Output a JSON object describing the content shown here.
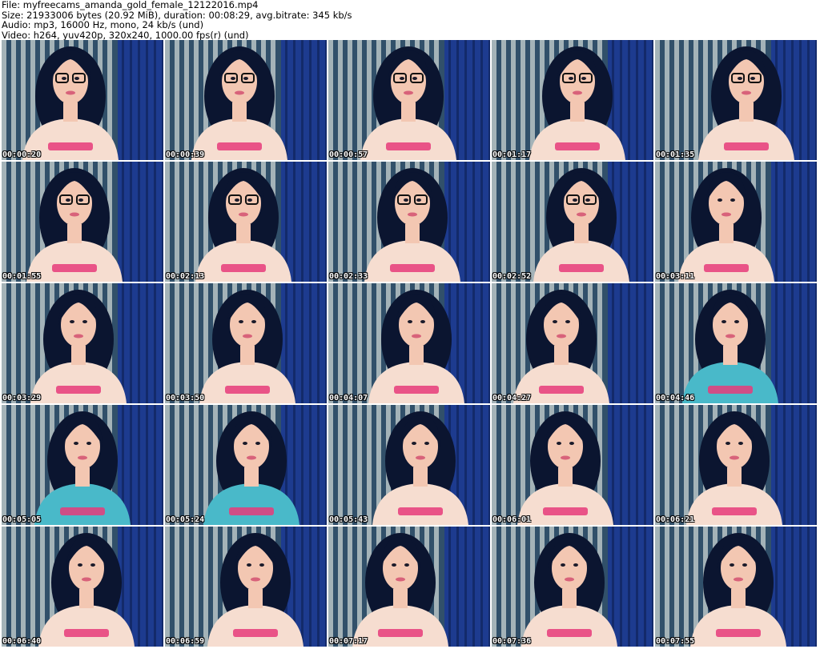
{
  "header": {
    "file_line": "File: myfreecams_amanda_gold_female_12122016.mp4",
    "size_line": "Size: 21933006 bytes (20.92 MiB), duration: 00:08:29, avg.bitrate: 345 kb/s",
    "audio_line": "Audio: mp3, 16000 Hz, mono, 24 kb/s (und)",
    "video_line": "Video: h264, yuv420p, 320x240, 1000.00 fps(r) (und)"
  },
  "colors": {
    "stripe_light": "#b9c4c6",
    "stripe_dark": "#31506a",
    "curtain": "#1d3b8f",
    "hair": "#0b1530",
    "skin": "#f3c7b2",
    "shirt": "#f6ddd0",
    "shirt_print": "#e63b7a"
  },
  "thumbnails": [
    {
      "time": "00:00:20"
    },
    {
      "time": "00:00:39"
    },
    {
      "time": "00:00:57"
    },
    {
      "time": "00:01:17"
    },
    {
      "time": "00:01:35"
    },
    {
      "time": "00:01:55"
    },
    {
      "time": "00:02:13"
    },
    {
      "time": "00:02:33"
    },
    {
      "time": "00:02:52"
    },
    {
      "time": "00:03:11"
    },
    {
      "time": "00:03:29"
    },
    {
      "time": "00:03:50"
    },
    {
      "time": "00:04:07"
    },
    {
      "time": "00:04:27"
    },
    {
      "time": "00:04:46"
    },
    {
      "time": "00:05:05"
    },
    {
      "time": "00:05:24"
    },
    {
      "time": "00:05:43"
    },
    {
      "time": "00:06:01"
    },
    {
      "time": "00:06:21"
    },
    {
      "time": "00:06:40"
    },
    {
      "time": "00:06:59"
    },
    {
      "time": "00:07:17"
    },
    {
      "time": "00:07:36"
    },
    {
      "time": "00:07:55"
    }
  ]
}
